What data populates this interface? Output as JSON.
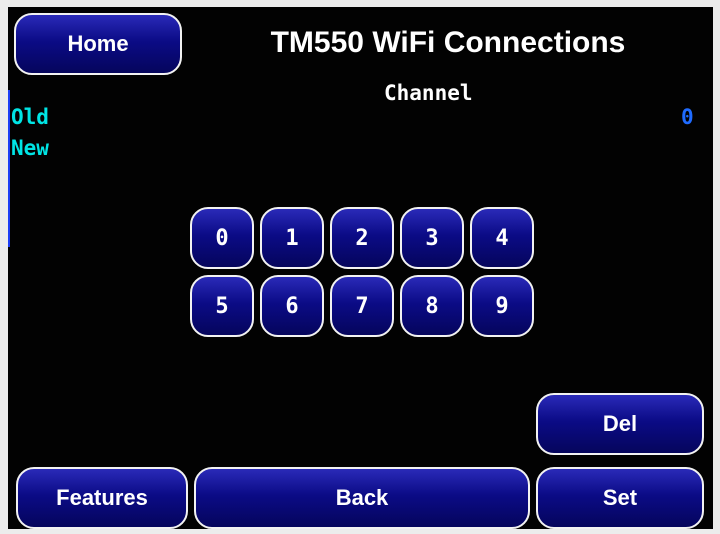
{
  "header": {
    "home_label": "Home",
    "title": "TM550 WiFi Connections",
    "field_label": "Channel"
  },
  "values": {
    "old_label": "Old",
    "new_label": "New",
    "old_value": "0"
  },
  "keypad": {
    "keys": [
      "0",
      "1",
      "2",
      "3",
      "4",
      "5",
      "6",
      "7",
      "8",
      "9"
    ]
  },
  "footer": {
    "del_label": "Del",
    "features_label": "Features",
    "back_label": "Back",
    "set_label": "Set"
  },
  "colors": {
    "accent_cyan": "#00e5e5",
    "value_blue": "#1f6bff",
    "button_blue": "#0b0b86"
  }
}
